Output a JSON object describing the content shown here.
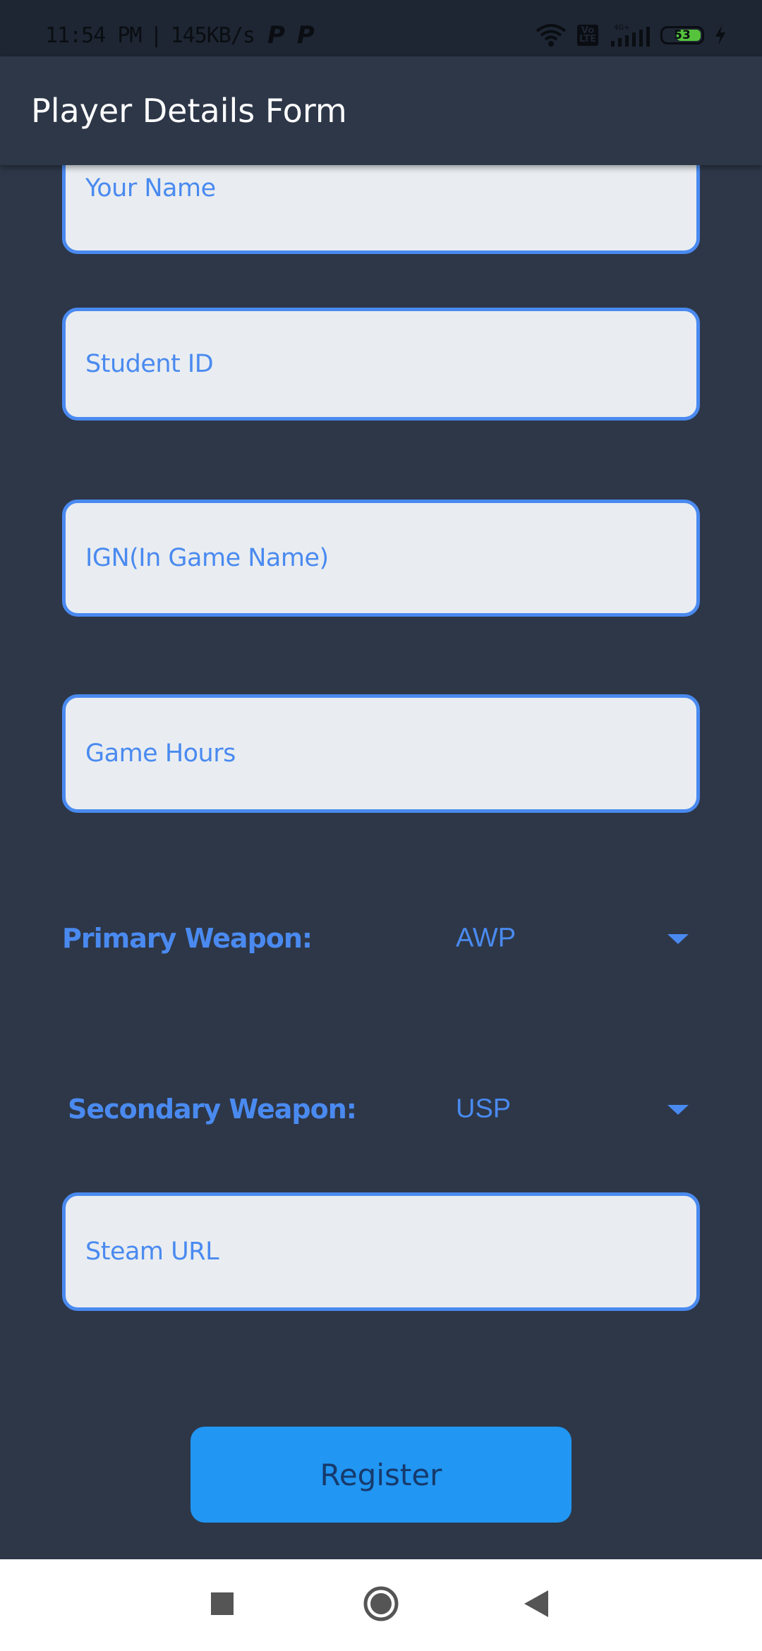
{
  "status_bar": {
    "time": "11:54 PM",
    "separator": "|",
    "network_speed": "145KB/s",
    "notification_icons": [
      "p-app-icon",
      "p-app-icon"
    ],
    "battery_level": "53",
    "volte_label": "Vo LTE",
    "signal_label": "4G+"
  },
  "app_bar": {
    "title": "Player Details Form"
  },
  "form": {
    "name_placeholder": "Your Name",
    "student_id_placeholder": "Student ID",
    "ign_placeholder": "IGN(In Game Name)",
    "game_hours_placeholder": "Game Hours",
    "primary_weapon": {
      "label": "Primary Weapon:",
      "value": "AWP"
    },
    "secondary_weapon": {
      "label": "Secondary Weapon:",
      "value": "USP"
    },
    "steam_url_placeholder": "Steam URL",
    "register_label": "Register"
  },
  "nav_bar": {
    "buttons": [
      "recents-icon",
      "home-icon",
      "back-icon"
    ]
  },
  "colors": {
    "background": "#2d3748",
    "status_bar": "#1e2633",
    "accent": "#4a8af0",
    "field_fill": "#e9edf1",
    "button": "#2196f3",
    "battery": "#55c43c"
  }
}
